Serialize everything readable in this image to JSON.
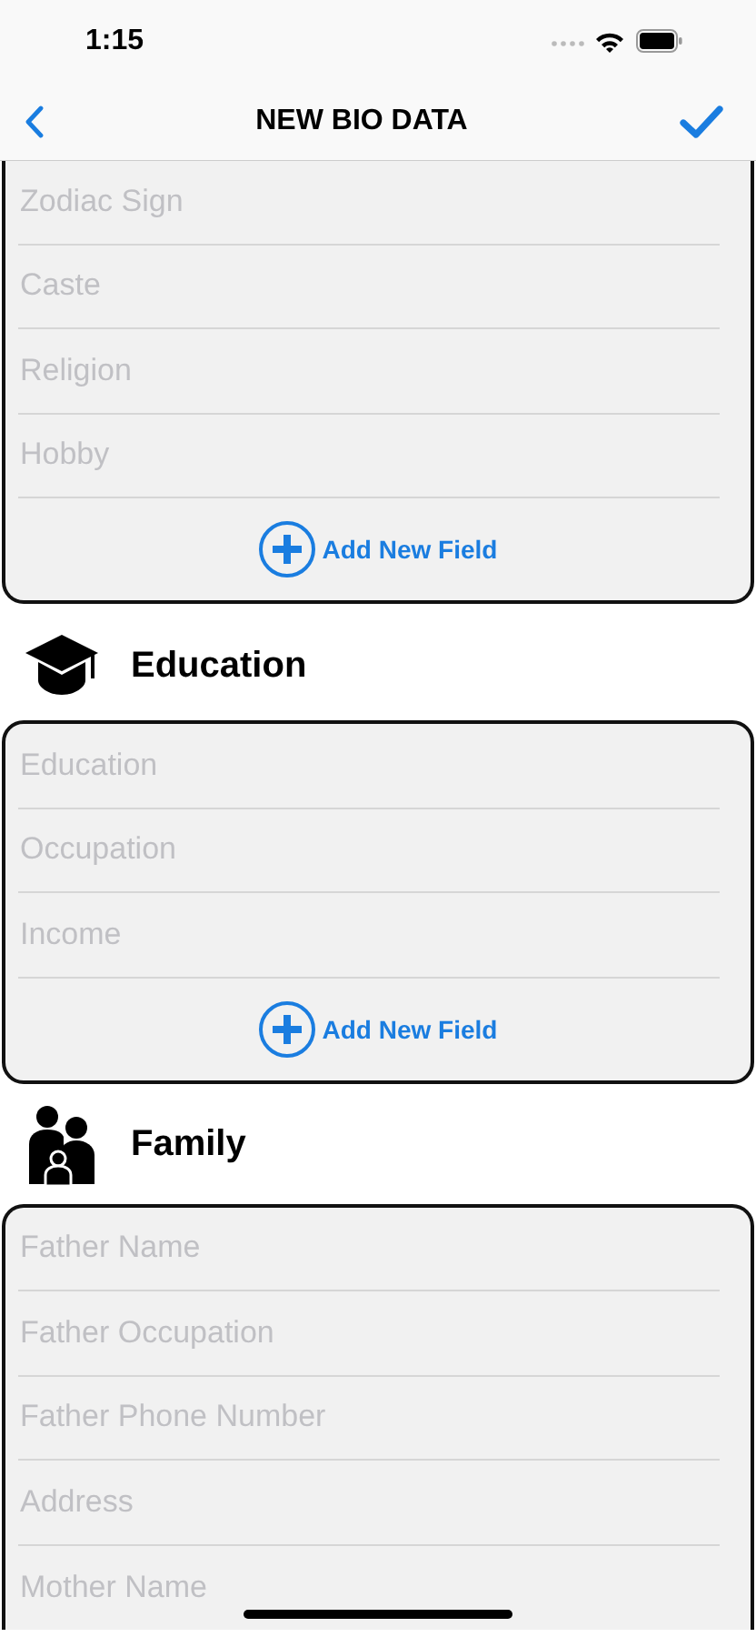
{
  "status_bar": {
    "time": "1:15"
  },
  "nav": {
    "title": "NEW BIO DATA"
  },
  "sections": [
    {
      "fields": [
        {
          "placeholder": "Zodiac Sign"
        },
        {
          "placeholder": "Caste"
        },
        {
          "placeholder": "Religion"
        },
        {
          "placeholder": "Hobby"
        }
      ],
      "add_button": "Add New Field"
    },
    {
      "title": "Education",
      "kind": "cap",
      "fields": [
        {
          "placeholder": "Education"
        },
        {
          "placeholder": "Occupation"
        },
        {
          "placeholder": "Income"
        }
      ],
      "add_button": "Add New Field"
    },
    {
      "title": "Family",
      "kind": "family",
      "fields": [
        {
          "placeholder": "Father Name"
        },
        {
          "placeholder": "Father Occupation"
        },
        {
          "placeholder": "Father Phone Number"
        },
        {
          "placeholder": "Address"
        },
        {
          "placeholder": "Mother Name"
        }
      ]
    }
  ]
}
